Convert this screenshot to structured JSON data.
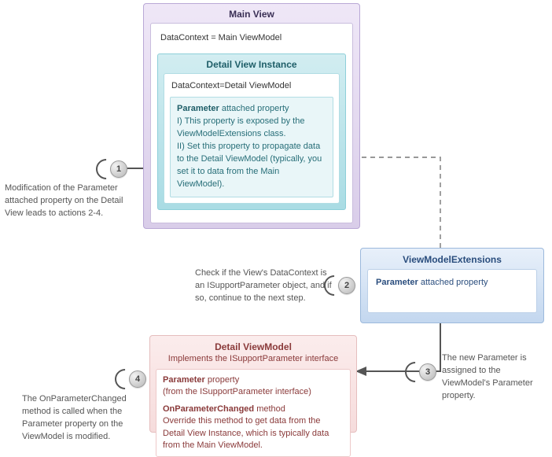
{
  "mainView": {
    "title": "Main View",
    "dataContext": "DataContext = Main ViewModel"
  },
  "detailView": {
    "title": "Detail View Instance",
    "dataContext": "DataContext=Detail ViewModel",
    "param": {
      "heading": "Parameter",
      "headingSuffix": " attached property",
      "line1": "I)  This property is exposed by the ViewModelExtensions class.",
      "line2": "II) Set this property to propagate data to the Detail ViewModel (typically, you set it to data from the Main ViewModel)."
    }
  },
  "vme": {
    "title": "ViewModelExtensions",
    "paramStrong": "Parameter",
    "paramSuffix": " attached property"
  },
  "dvm": {
    "title": "Detail ViewModel",
    "subtitle": "Implements the ISupportParameter interface",
    "paramStrong": "Parameter",
    "paramSuffix": " property",
    "paramNote": "(from the ISupportParameter interface)",
    "opcStrong": "OnParameterChanged",
    "opcSuffix": " method",
    "opcNote": "Override this method to get data from the Detail View Instance, which is typically data from the Main ViewModel."
  },
  "steps": {
    "s1": "1",
    "s2": "2",
    "s3": "3",
    "s4": "4"
  },
  "captions": {
    "c1": "Modification of the Parameter attached property on the Detail View leads to actions 2-4.",
    "c2": "Check if the View's DataContext is an ISupportParameter object, and if so, continue to the next step.",
    "c3": "The new Parameter is assigned to the ViewModel's Parameter property.",
    "c4": "The OnParameterChanged method is called when the Parameter property on the ViewModel is modified."
  }
}
